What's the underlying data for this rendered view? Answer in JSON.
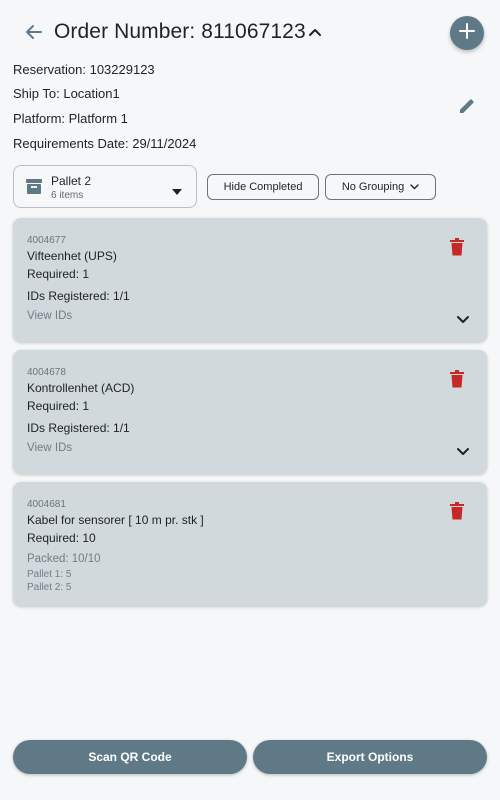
{
  "header": {
    "title": "Order Number: 811067123",
    "back_icon": "arrow-left-icon",
    "collapse_icon": "chevron-up-icon",
    "add_icon": "plus-icon"
  },
  "info": {
    "reservation": "Reservation: 103229123",
    "ship_to": "Ship To: Location1",
    "platform": "Platform: Platform 1",
    "requirements_date": "Requirements Date: 29/11/2024",
    "edit_icon": "pencil-icon"
  },
  "pallet_select": {
    "name": "Pallet 2",
    "count": "6 items",
    "icon": "archive-box-icon"
  },
  "filters": {
    "hide_completed": "Hide Completed",
    "grouping": "No Grouping"
  },
  "items": [
    {
      "code": "4004677",
      "name": "Vifteenhet (UPS)",
      "required": "Required: 1",
      "ids_registered": "IDs Registered: 1/1",
      "view_ids": "View IDs"
    },
    {
      "code": "4004678",
      "name": "Kontrollenhet (ACD)",
      "required": "Required: 1",
      "ids_registered": "IDs Registered: 1/1",
      "view_ids": "View IDs"
    },
    {
      "code": "4004681",
      "name": "Kabel for sensorer [ 10 m pr. stk ]",
      "required": "Required: 10",
      "packed": "Packed: 10/10",
      "pallet_1": "Pallet 1: 5",
      "pallet_2": "Pallet 2: 5"
    }
  ],
  "actions": {
    "scan": "Scan QR Code",
    "export": "Export Options"
  },
  "colors": {
    "accent": "#5f7a86",
    "card": "#d1d9dd",
    "delete": "#c62828",
    "background": "#f6f7f9"
  }
}
